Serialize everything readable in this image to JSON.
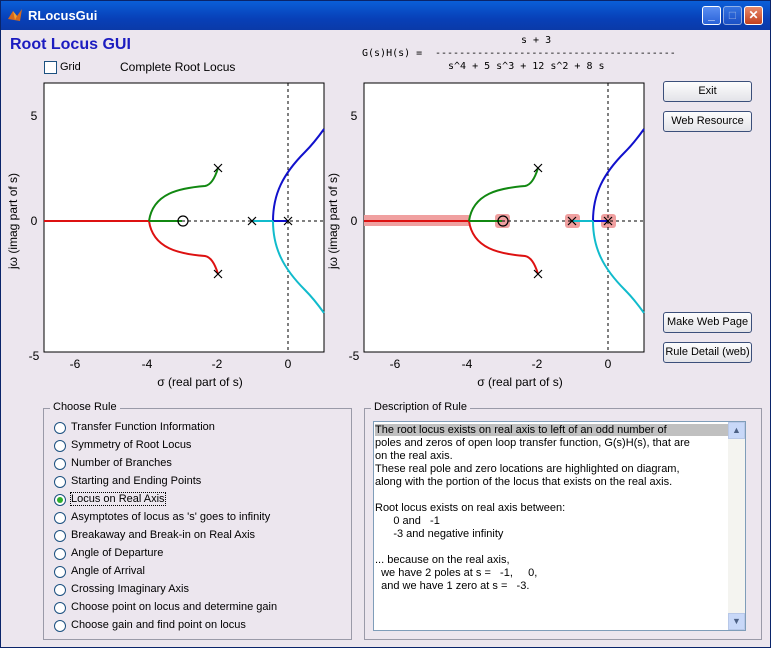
{
  "window": {
    "title": "RLocusGui",
    "minimize_label": "_",
    "maximize_label": "□",
    "close_label": "✕"
  },
  "header": {
    "title": "Root Locus GUI",
    "grid_label": "Grid",
    "grid_checked": false,
    "plot_title": "Complete Root Locus"
  },
  "transfer_function": {
    "lhs": "G(s)H(s) =",
    "numerator": "s + 3",
    "denominator": "s^4 + 5 s^3 + 12 s^2 + 8 s",
    "divider": "----------------------------------------"
  },
  "buttons": {
    "exit": "Exit",
    "web_resource": "Web Resource",
    "make_web_page": "Make Web Page",
    "rule_detail": "Rule Detail (web)"
  },
  "plots": {
    "xlabel": "σ (real part of s)",
    "ylabel": "jω (imag part of s)",
    "xticks": [
      "-6",
      "-4",
      "-2",
      "0"
    ],
    "yticks": [
      "5",
      "0",
      "-5"
    ]
  },
  "choose_rule": {
    "title": "Choose Rule",
    "selected_index": 4,
    "rules": [
      "Transfer Function Information",
      "Symmetry of Root Locus",
      "Number of Branches",
      "Starting and Ending Points",
      "Locus on Real Axis",
      "Asymptotes of locus as 's' goes to infinity",
      "Breakaway and Break-in on Real Axis",
      "Angle of Departure",
      "Angle of Arrival",
      "Crossing Imaginary Axis",
      "Choose point on locus and determine gain",
      "Choose gain and find point on locus"
    ]
  },
  "description": {
    "title": "Description of Rule",
    "lines": [
      "The root locus exists on real axis to left of an odd number of",
      "poles and zeros of open loop transfer function, G(s)H(s), that are",
      "on the real axis.",
      "These real pole and zero locations are highlighted on diagram,",
      "along with the portion of the locus that exists on the real axis.",
      "",
      "Root locus exists on real axis between:",
      "      0 and   -1",
      "      -3 and negative infinity",
      "",
      "... because on the real axis,",
      "  we have 2 poles at s =   -1,     0,",
      "  and we have 1 zero at s =   -3."
    ]
  },
  "colors": {
    "branch_red": "#dd1111",
    "branch_green": "#118811",
    "branch_blue": "#1111cc",
    "branch_cyan": "#11bbcc",
    "highlight": "#f0a0a0",
    "title_blue": "#1c1cc0"
  }
}
